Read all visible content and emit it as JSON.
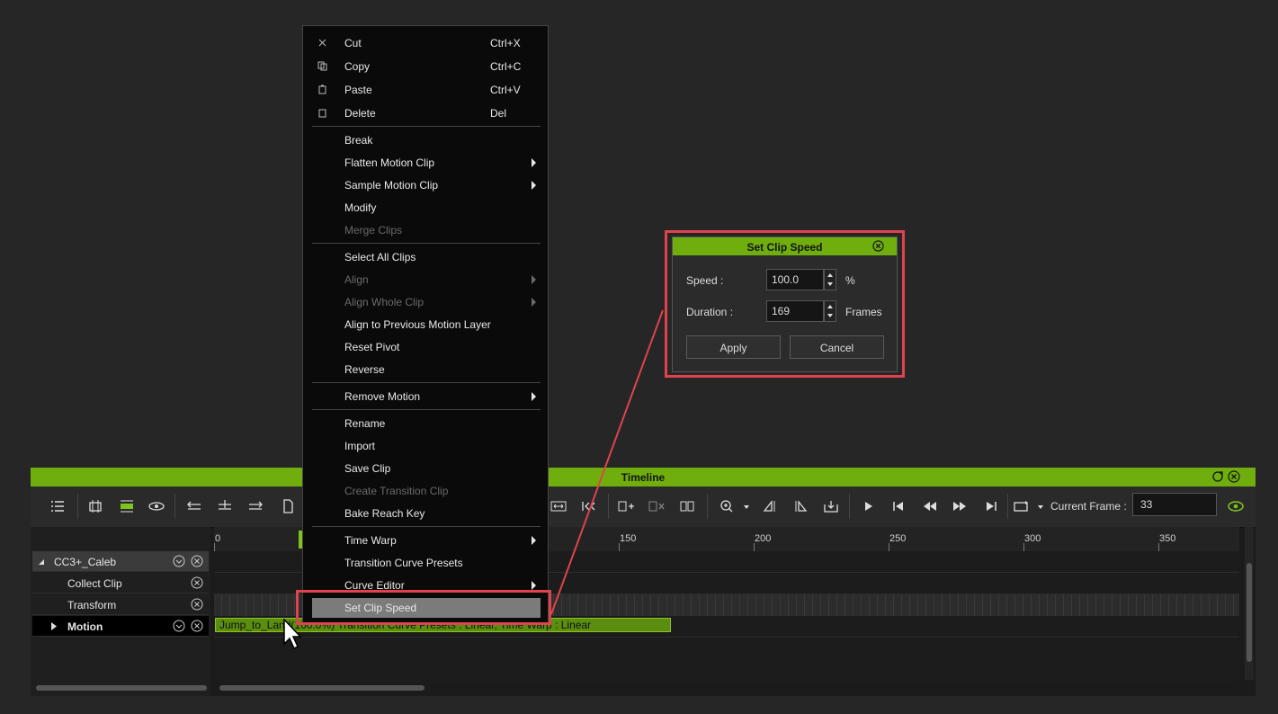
{
  "timeline": {
    "title": "Timeline",
    "current_frame_label": "Current Frame :",
    "current_frame_value": "33",
    "ruler": {
      "ticks": [
        {
          "label": "0",
          "frame": 0
        },
        {
          "label": "150",
          "frame": 150
        },
        {
          "label": "200",
          "frame": 200
        },
        {
          "label": "250",
          "frame": 250
        },
        {
          "label": "300",
          "frame": 300
        },
        {
          "label": "350",
          "frame": 350
        }
      ]
    },
    "tracks": {
      "character": "CC3+_Caleb",
      "collect_clip": "Collect Clip",
      "transform": "Transform",
      "motion": "Motion"
    },
    "clip_text": "Jump_to_Land(100.0%) Transition Curve Presets : Linear, Time Warp : Linear"
  },
  "menu": {
    "cut": "Cut",
    "cut_shortcut": "Ctrl+X",
    "copy": "Copy",
    "copy_shortcut": "Ctrl+C",
    "paste": "Paste",
    "paste_shortcut": "Ctrl+V",
    "delete": "Delete",
    "delete_shortcut": "Del",
    "break": "Break",
    "flatten": "Flatten Motion Clip",
    "sample": "Sample Motion Clip",
    "modify": "Modify",
    "merge": "Merge Clips",
    "select_all": "Select All Clips",
    "align": "Align",
    "align_whole": "Align Whole Clip",
    "align_prev": "Align to Previous Motion Layer",
    "reset_pivot": "Reset Pivot",
    "reverse": "Reverse",
    "remove_motion": "Remove Motion",
    "rename": "Rename",
    "import": "Import",
    "save_clip": "Save Clip",
    "create_transition": "Create Transition Clip",
    "bake_reach": "Bake Reach Key",
    "time_warp": "Time Warp",
    "transition_presets": "Transition Curve Presets",
    "curve_editor": "Curve Editor",
    "set_clip_speed": "Set Clip Speed"
  },
  "dialog": {
    "title": "Set Clip Speed",
    "speed_label": "Speed :",
    "speed_value": "100.0",
    "speed_unit": "%",
    "duration_label": "Duration :",
    "duration_value": "169",
    "duration_unit": "Frames",
    "apply": "Apply",
    "cancel": "Cancel"
  },
  "colors": {
    "accent_green": "#6fae0d",
    "highlight_red": "#e0434b",
    "menu_highlight": "#7b7b7b"
  }
}
